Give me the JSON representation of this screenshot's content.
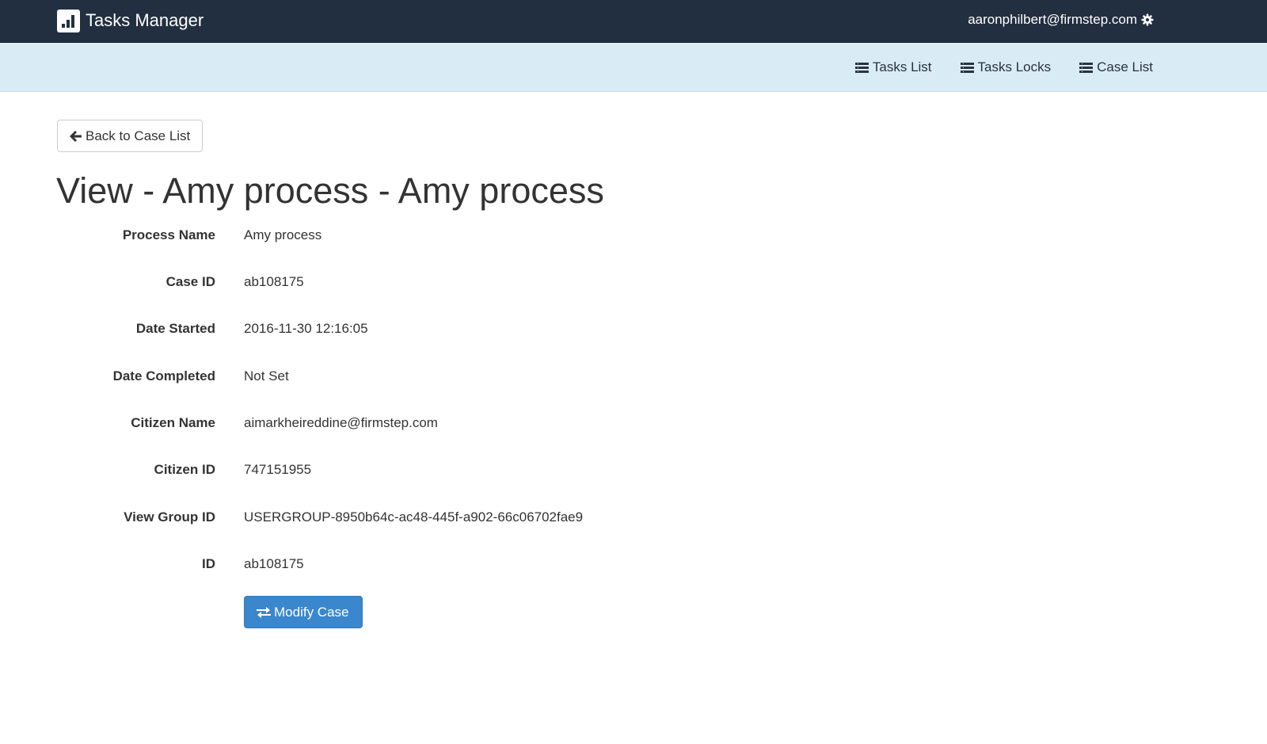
{
  "header": {
    "app_title": "Tasks Manager",
    "logo_icon": "bar-chart-icon",
    "user_email": "aaronphilbert@firmstep.com",
    "settings_icon": "gear-icon",
    "background_color": "#222f40"
  },
  "subnav": {
    "background_color": "#d9ecf5",
    "items": [
      {
        "label": "Tasks List",
        "icon": "list-icon"
      },
      {
        "label": "Tasks Locks",
        "icon": "list-icon"
      },
      {
        "label": "Case List",
        "icon": "list-icon"
      }
    ]
  },
  "main": {
    "back_button": {
      "label": "Back to Case List",
      "icon": "arrow-left-icon"
    },
    "title": "View - Amy process - Amy process",
    "details": [
      {
        "label": "Process Name",
        "value": "Amy process"
      },
      {
        "label": "Case ID",
        "value": "ab108175"
      },
      {
        "label": "Date Started",
        "value": "2016-11-30 12:16:05"
      },
      {
        "label": "Date Completed",
        "value": "Not Set"
      },
      {
        "label": "Citizen Name",
        "value": "aimarkheireddine@firmstep.com"
      },
      {
        "label": "Citizen ID",
        "value": "747151955"
      },
      {
        "label": "View Group ID",
        "value": "USERGROUP-8950b64c-ac48-445f-a902-66c06702fae9"
      },
      {
        "label": "ID",
        "value": "ab108175"
      }
    ],
    "modify_button": {
      "label": "Modify Case",
      "icon": "exchange-icon",
      "color": "#3a87cd"
    }
  }
}
